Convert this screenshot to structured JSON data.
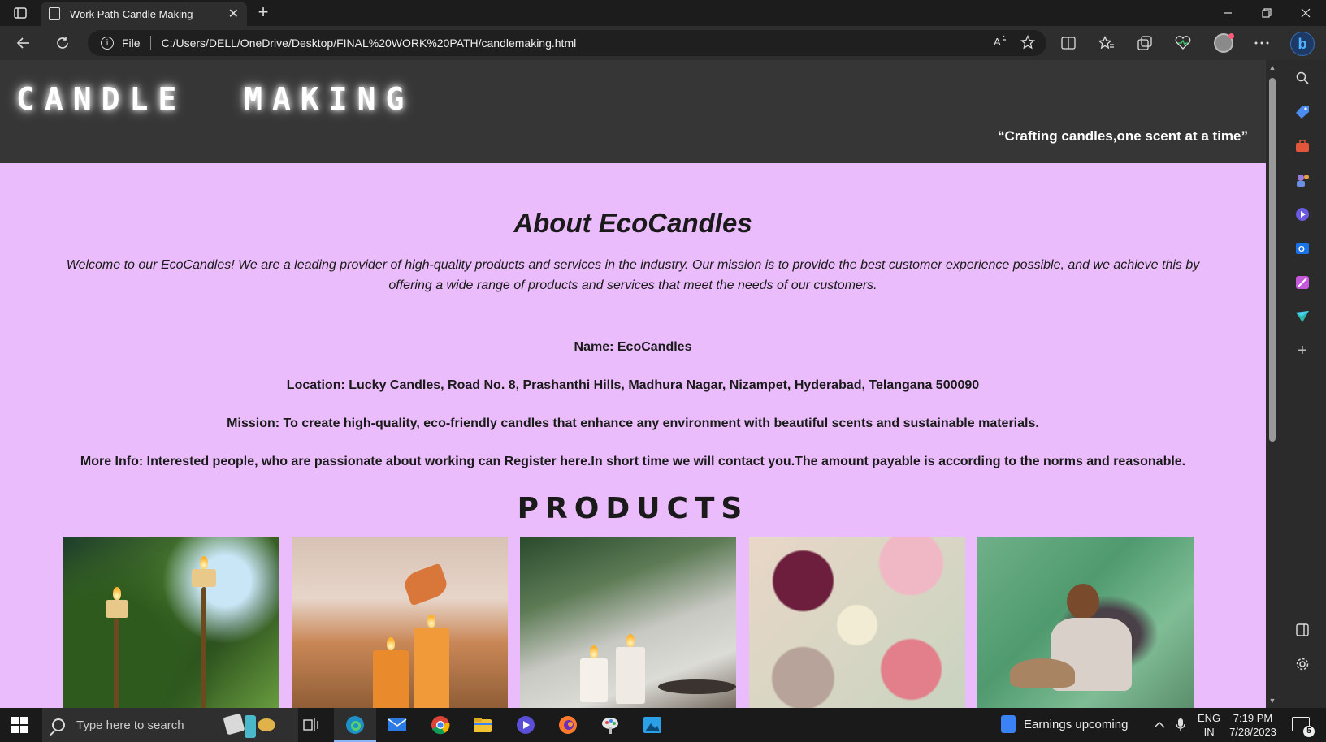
{
  "browser": {
    "tab_title": "Work Path-Candle Making",
    "tab_close": "✕",
    "new_tab": "+",
    "file_label": "File",
    "url": "C:/Users/DELL/OneDrive/Desktop/FINAL%20WORK%20PATH/candlemaking.html",
    "bing": "b"
  },
  "page": {
    "site_title": "CANDLE MAKING",
    "tagline": "“Crafting candles,one scent at a time”",
    "about_title": "About EcoCandles",
    "about_intro": "Welcome to our EcoCandles! We are a leading provider of high-quality products and services in the industry. Our mission is to provide the best customer experience possible, and we achieve this by offering a wide range of products and services that meet the needs of our customers.",
    "name_line": "Name: EcoCandles",
    "location_line": "Location: Lucky Candles, Road No. 8, Prashanthi Hills, Madhura Nagar, Nizampet, Hyderabad, Telangana 500090",
    "mission_line": "Mission: To create high-quality, eco-friendly candles that enhance any environment with beautiful scents and sustainable materials.",
    "more_info_line": "More Info: Interested people, who are passionate about working can Register here.In short time we will contact you.The amount payable is according to the norms and reasonable.",
    "products_title": "PRODUCTS"
  },
  "taskbar": {
    "search_placeholder": "Type here to search",
    "widget_text": "Earnings upcoming",
    "lang_top": "ENG",
    "lang_bottom": "IN",
    "time": "7:19 PM",
    "date": "7/28/2023",
    "notification_count": "5"
  },
  "colors": {
    "page_background": "#ebbcfb",
    "header_background": "#363636"
  }
}
